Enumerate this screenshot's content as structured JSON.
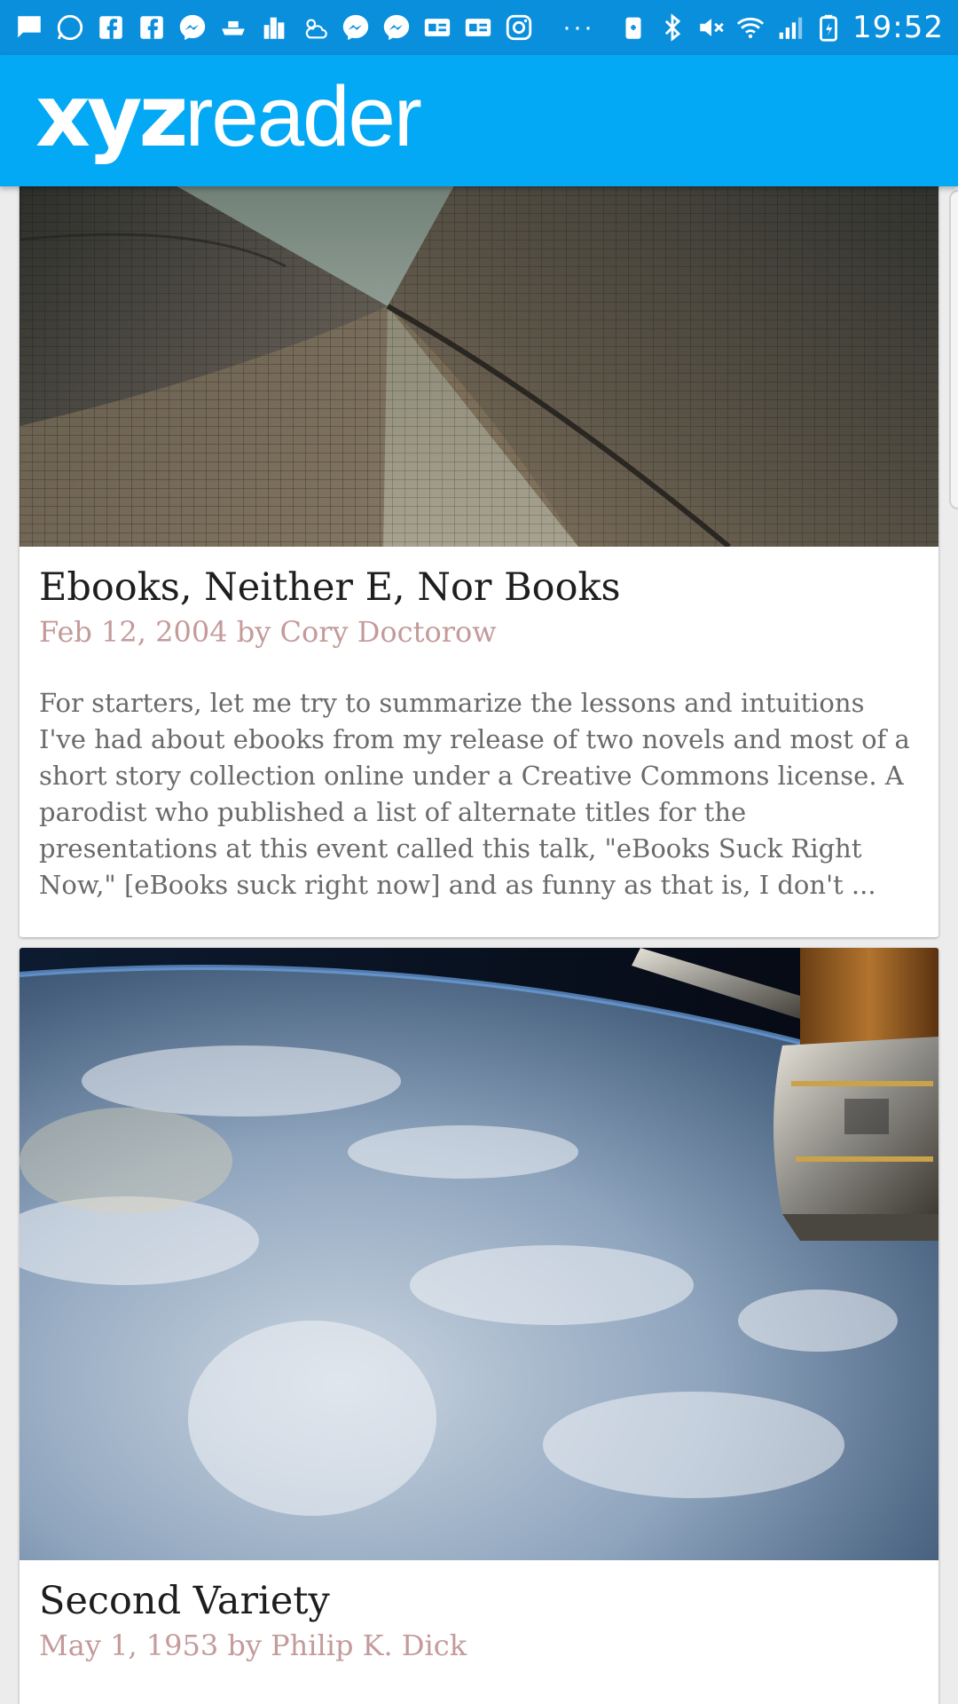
{
  "status_bar": {
    "time": "19:52",
    "left_icons": [
      "message-icon",
      "whatsapp-icon",
      "facebook-icon",
      "facebook-icon",
      "messenger-icon",
      "boat-icon",
      "city-icon",
      "weather-icon",
      "messenger-icon",
      "messenger-icon",
      "ge-icon",
      "ge-icon",
      "instagram-icon"
    ],
    "more": "···",
    "right_icons": [
      "battery-saver-icon",
      "bluetooth-icon",
      "mute-icon",
      "wifi-icon",
      "signal-icon",
      "battery-icon"
    ]
  },
  "app_bar": {
    "logo_bold": "xyz",
    "logo_light": "reader"
  },
  "articles": [
    {
      "title": "Ebooks, Neither E, Nor Books",
      "subtitle": "Feb 12, 2004 by Cory Doctorow",
      "excerpt": "For starters, let me try to summarize the lessons and intuitions I've had about ebooks from my release of two novels and most of a short story collection online under a Creative Commons license. A parodist who published a list of alternate titles for the presentations at this event called this talk, \"eBooks Suck Right Now,\" [eBooks suck right now] and as funny as that is, I don't ..."
    },
    {
      "title": "Second Variety",
      "subtitle": "May 1, 1953 by Philip K. Dick"
    }
  ],
  "colors": {
    "status_bar": "#0a8fdc",
    "app_bar": "#03a9f4",
    "subtitle": "#c49a9a"
  }
}
